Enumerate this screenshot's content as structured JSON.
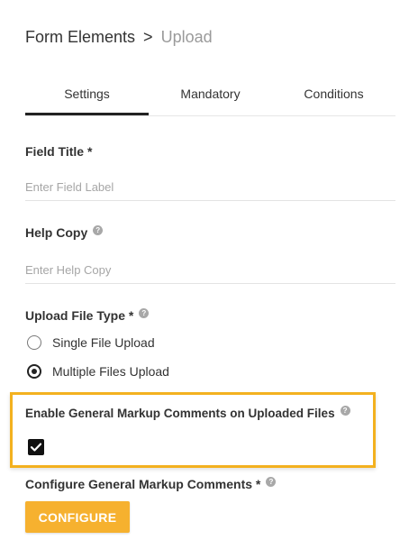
{
  "breadcrumb": {
    "parent": "Form Elements",
    "separator": ">",
    "current": "Upload"
  },
  "tabs": [
    {
      "label": "Settings",
      "active": true
    },
    {
      "label": "Mandatory",
      "active": false
    },
    {
      "label": "Conditions",
      "active": false
    }
  ],
  "field_title": {
    "label": "Field Title *",
    "placeholder": "Enter Field Label",
    "value": ""
  },
  "help_copy": {
    "label": "Help Copy",
    "placeholder": "Enter Help Copy",
    "value": ""
  },
  "upload_type": {
    "label": "Upload File Type *",
    "options": [
      {
        "label": "Single File Upload",
        "selected": false
      },
      {
        "label": "Multiple Files Upload",
        "selected": true
      }
    ]
  },
  "markup_comments": {
    "label": "Enable General Markup Comments on Uploaded Files",
    "checked": true
  },
  "configure": {
    "label": "Configure General Markup Comments *",
    "button_label": "CONFIGURE"
  },
  "colors": {
    "accent": "#f6b12f",
    "highlight_border": "#f3b11f",
    "text": "#333333",
    "muted": "#9a9a9a"
  }
}
